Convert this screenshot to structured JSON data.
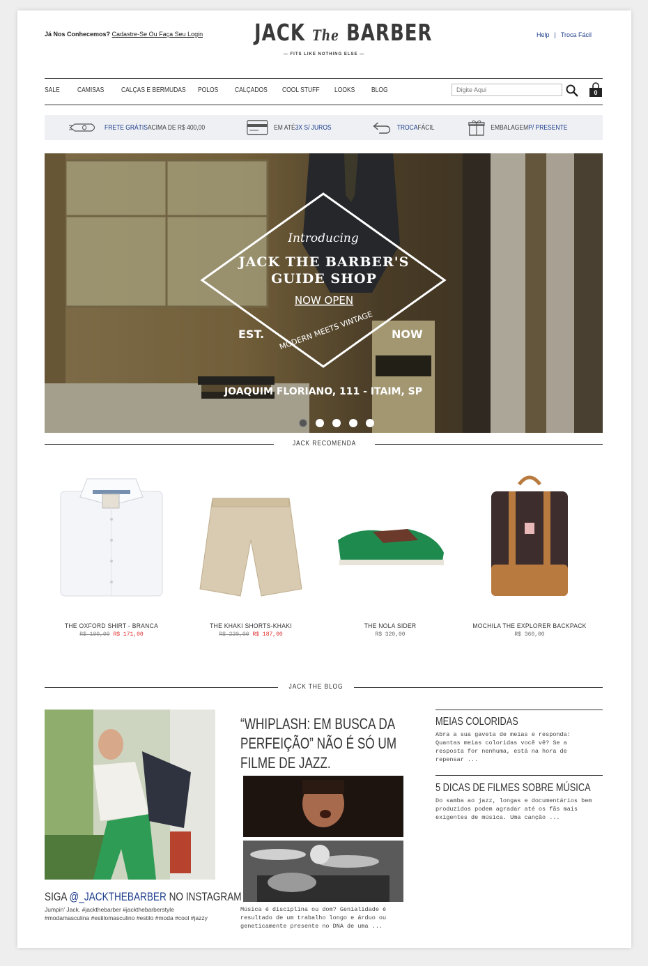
{
  "header": {
    "login_prompt": "Já Nos Conhecemos?",
    "login_link": "Cadastre-Se Ou Faça Seu Login",
    "logo_left": "JACK",
    "logo_mid": "The",
    "logo_right": "BARBER",
    "tagline": "— FITS LIKE NOTHING ELSE —",
    "help": "Help",
    "separator": "|",
    "troca": "Troca Fácil"
  },
  "nav": {
    "items": [
      "SALE",
      "CAMISAS",
      "CALÇAS E BERMUDAS",
      "POLOS",
      "CALÇADOS",
      "COOL STUFF",
      "LOOKS",
      "BLOG"
    ],
    "search_placeholder": "Digite Aqui",
    "cart_count": "0"
  },
  "benefits": [
    {
      "icon": "rocket-icon",
      "hl": "FRETE GRÁTIS",
      "rest": " ACIMA DE R$ 400,00"
    },
    {
      "icon": "credit-card-icon",
      "rest": "EM ATÉ ",
      "hl": "3X S/ JUROS"
    },
    {
      "icon": "return-arrow-icon",
      "hl": "TROCA",
      "rest": " FÁCIL"
    },
    {
      "icon": "gift-icon",
      "rest": "EMBALAGEM ",
      "hl": "P/ PRESENTE"
    }
  ],
  "hero": {
    "intro": "Introducing",
    "title1": "JACK THE BARBER'S",
    "title2": "GUIDE SHOP",
    "status": "NOW OPEN",
    "arc": "MODERN MEETS VINTAGE",
    "est": "EST.",
    "now": "NOW",
    "address": "JOAQUIM FLORIANO, 111 - ITAIM, SP",
    "slides": 5,
    "active_slide": 1
  },
  "recommend": {
    "title": "JACK RECOMENDA",
    "products": [
      {
        "name": "THE OXFORD SHIRT - BRANCA",
        "old": "R$ 190,00",
        "new": "R$ 171,00"
      },
      {
        "name": "THE KHAKI SHORTS-KHAKI",
        "old": "R$ 220,00",
        "new": "R$ 187,00"
      },
      {
        "name": "THE NOLA SIDER",
        "price": "R$ 320,00"
      },
      {
        "name": "MOCHILA THE EXPLORER BACKPACK",
        "price": "R$ 360,00"
      }
    ]
  },
  "blog": {
    "title": "JACK THE BLOG",
    "instagram_pre": "SIGA ",
    "instagram_handle": "@_JACKTHEBARBER",
    "instagram_post": " NO INSTAGRAM",
    "instagram_text": "Jumpin' Jack. #jackthebarber #jackthebarberstyle #modamasculina #estilomasculino #estilo #moda #cool #jazzy",
    "main_title": "“WHIPLASH: EM BUSCA DA PERFEIÇÃO” NÃO É SÓ UM FILME DE JAZZ.",
    "main_text": "Música é disciplina ou dom? Genialidade é resultado de um trabalho longo e árduo ou geneticamente presente no DNA de uma ...",
    "side": [
      {
        "title": "MEIAS COLORIDAS",
        "text": "Abra a sua gaveta de meias e responda: Quantas meias coloridas você vê? Se a resposta for nenhuma, está na hora de repensar ..."
      },
      {
        "title": "5 DICAS DE FILMES SOBRE MÚSICA",
        "text": "Do samba ao jazz, longas e documentários bem produzidos podem agradar até os fãs mais exigentes de música.  Uma canção ..."
      }
    ]
  },
  "colors": {
    "accent_blue": "#1f3f8c",
    "sale_red": "#e02d2d"
  }
}
